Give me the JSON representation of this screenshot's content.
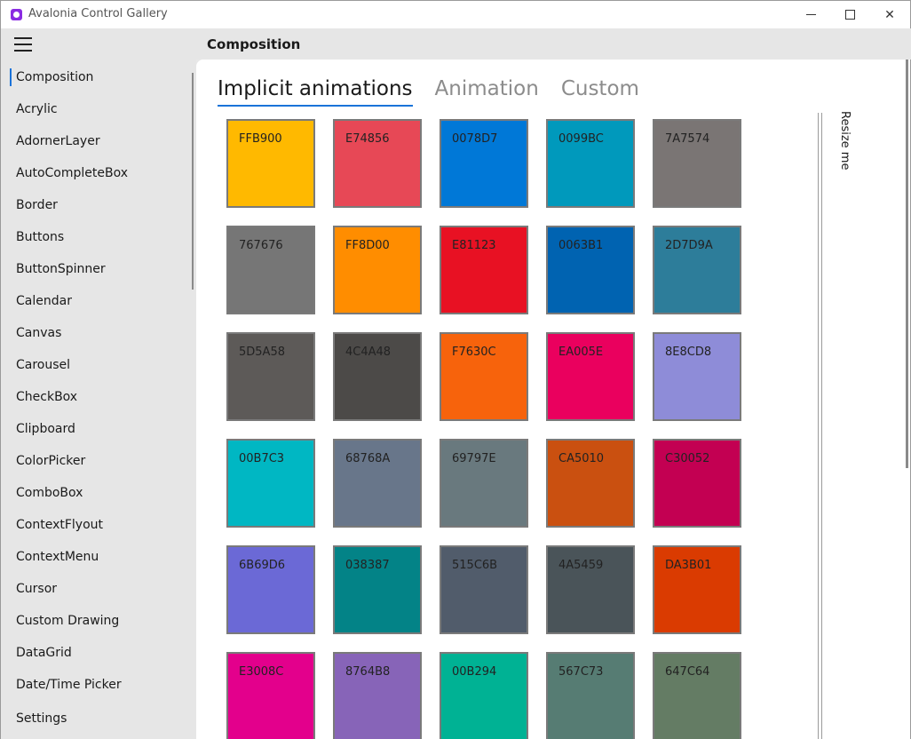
{
  "window": {
    "title": "Avalonia Control Gallery",
    "minimize": "minimize",
    "maximize": "maximize",
    "close": "✕"
  },
  "header": {
    "title": "Composition"
  },
  "sidebar": {
    "items": [
      {
        "label": "Composition",
        "selected": true
      },
      {
        "label": "Acrylic"
      },
      {
        "label": "AdornerLayer"
      },
      {
        "label": "AutoCompleteBox"
      },
      {
        "label": "Border"
      },
      {
        "label": "Buttons"
      },
      {
        "label": "ButtonSpinner"
      },
      {
        "label": "Calendar"
      },
      {
        "label": "Canvas"
      },
      {
        "label": "Carousel"
      },
      {
        "label": "CheckBox"
      },
      {
        "label": "Clipboard"
      },
      {
        "label": "ColorPicker"
      },
      {
        "label": "ComboBox"
      },
      {
        "label": "ContextFlyout"
      },
      {
        "label": "ContextMenu"
      },
      {
        "label": "Cursor"
      },
      {
        "label": "Custom Drawing"
      },
      {
        "label": "DataGrid"
      },
      {
        "label": "Date/Time Picker"
      }
    ],
    "settings": "Settings"
  },
  "tabs": [
    {
      "label": "Implicit animations",
      "active": true
    },
    {
      "label": "Animation"
    },
    {
      "label": "Custom"
    }
  ],
  "tiles": [
    {
      "label": "FFB900",
      "color": "#FFB900"
    },
    {
      "label": "E74856",
      "color": "#E74856"
    },
    {
      "label": "0078D7",
      "color": "#0078D7"
    },
    {
      "label": "0099BC",
      "color": "#0099BC"
    },
    {
      "label": "7A7574",
      "color": "#7A7574"
    },
    {
      "label": "767676",
      "color": "#767676"
    },
    {
      "label": "FF8D00",
      "color": "#FF8D00"
    },
    {
      "label": "E81123",
      "color": "#E81123"
    },
    {
      "label": "0063B1",
      "color": "#0063B1"
    },
    {
      "label": "2D7D9A",
      "color": "#2D7D9A"
    },
    {
      "label": "5D5A58",
      "color": "#5D5A58"
    },
    {
      "label": "4C4A48",
      "color": "#4C4A48"
    },
    {
      "label": "F7630C",
      "color": "#F7630C"
    },
    {
      "label": "EA005E",
      "color": "#EA005E"
    },
    {
      "label": "8E8CD8",
      "color": "#8E8CD8"
    },
    {
      "label": "00B7C3",
      "color": "#00B7C3"
    },
    {
      "label": "68768A",
      "color": "#68768A"
    },
    {
      "label": "69797E",
      "color": "#69797E"
    },
    {
      "label": "CA5010",
      "color": "#CA5010"
    },
    {
      "label": "C30052",
      "color": "#C30052"
    },
    {
      "label": "6B69D6",
      "color": "#6B69D6"
    },
    {
      "label": "038387",
      "color": "#038387"
    },
    {
      "label": "515C6B",
      "color": "#515C6B"
    },
    {
      "label": "4A5459",
      "color": "#4A5459"
    },
    {
      "label": "DA3B01",
      "color": "#DA3B01"
    },
    {
      "label": "E3008C",
      "color": "#E3008C"
    },
    {
      "label": "8764B8",
      "color": "#8764B8"
    },
    {
      "label": "00B294",
      "color": "#00B294"
    },
    {
      "label": "567C73",
      "color": "#567C73"
    },
    {
      "label": "647C64",
      "color": "#647C64"
    }
  ],
  "resize_label": "Resize me",
  "accent_color": "#1A73D9"
}
